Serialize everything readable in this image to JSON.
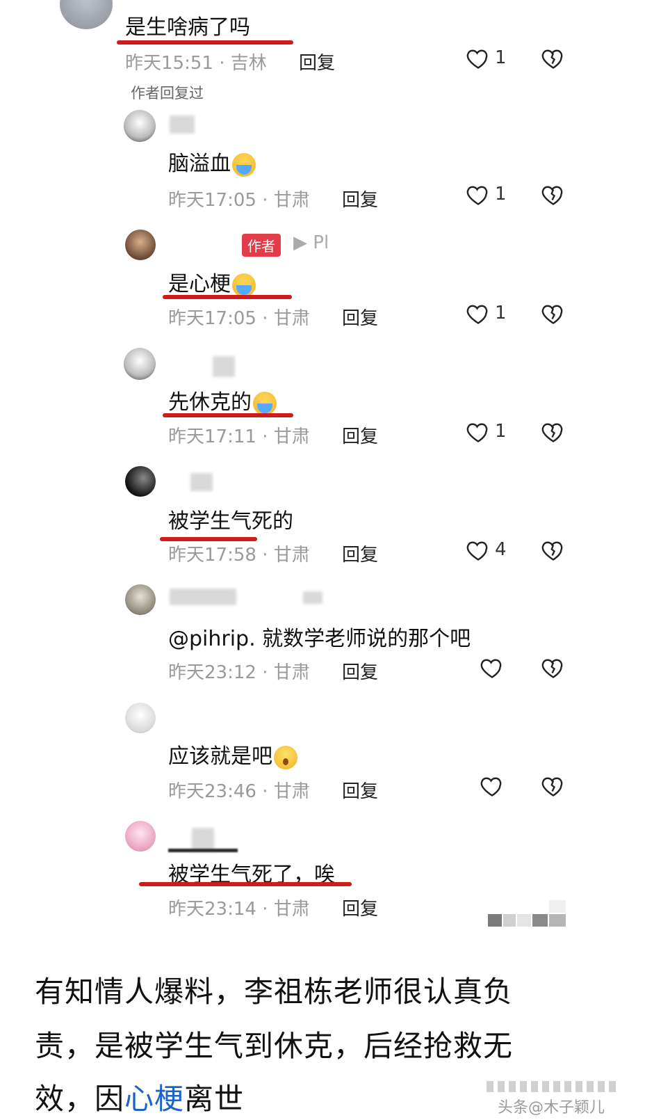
{
  "comments": [
    {
      "text": "是生啥病了吗",
      "time": "昨天15:51",
      "location": "吉林",
      "reply_label": "回复",
      "likes": "1",
      "author_replied": "作者回复过"
    },
    {
      "text": "脑溢血",
      "emoji": "crying-emoji",
      "time": "昨天17:05",
      "location": "甘肃",
      "reply_label": "回复",
      "likes": "1"
    },
    {
      "author_badge": "作者",
      "reply_to": "▶ Pl",
      "text": "是心梗",
      "emoji": "crying-emoji",
      "time": "昨天17:05",
      "location": "甘肃",
      "reply_label": "回复",
      "likes": "1"
    },
    {
      "text": "先休克的",
      "emoji": "crying-emoji",
      "time": "昨天17:11",
      "location": "甘肃",
      "reply_label": "回复",
      "likes": "1"
    },
    {
      "text": "被学生气死的",
      "time": "昨天17:58",
      "location": "甘肃",
      "reply_label": "回复",
      "likes": "4"
    },
    {
      "text": "@pihrip. 就数学老师说的那个吧",
      "time": "昨天23:12",
      "location": "甘肃",
      "reply_label": "回复",
      "likes": ""
    },
    {
      "text": "应该就是吧",
      "emoji": "surprised-emoji",
      "time": "昨天23:46",
      "location": "甘肃",
      "reply_label": "回复",
      "likes": ""
    },
    {
      "text": "被学生气死了，唉",
      "time": "昨天23:14",
      "location": "甘肃",
      "reply_label": "回复"
    }
  ],
  "footer": {
    "line1": "有知情人爆料，李祖栋老师很认真负",
    "line2": "责，是被学生气到休克，后经抢救无",
    "line3_a": "效，因",
    "line3_link": "心梗",
    "line3_b": "离世",
    "watermark": "头条@木子颖儿"
  },
  "colors": {
    "underline": "#d11a1a",
    "author_badge": "#e23b4a",
    "link": "#1e63c8"
  },
  "icons": [
    "heart-outline-icon",
    "broken-heart-icon",
    "crying-emoji",
    "surprised-emoji"
  ]
}
